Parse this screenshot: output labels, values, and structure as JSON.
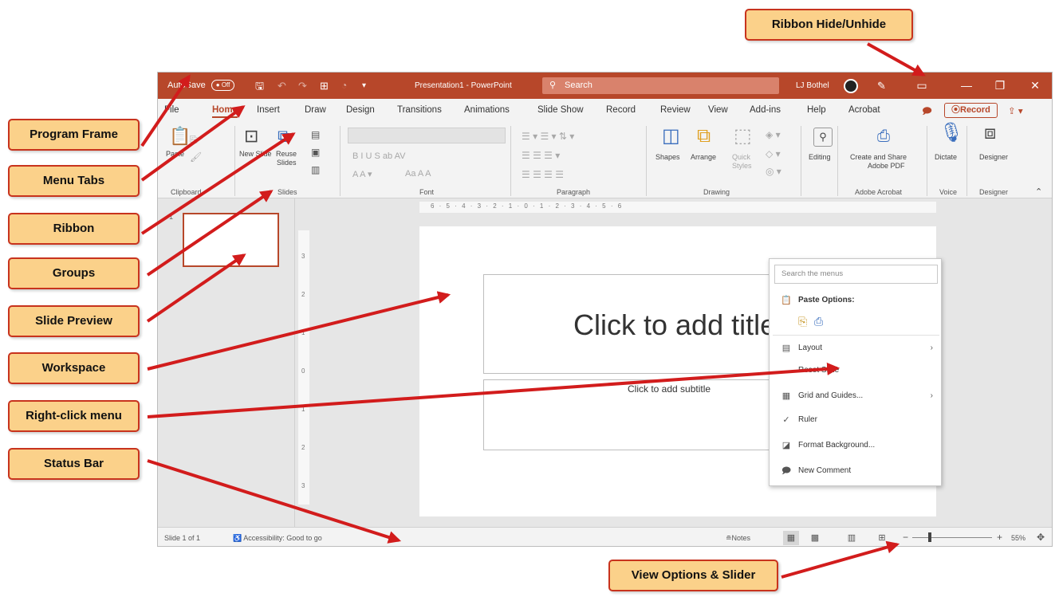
{
  "titlebar": {
    "autosave_label": "AutoSave",
    "autosave_state": "Off",
    "doc_title": "Presentation1 - PowerPoint",
    "search_placeholder": "Search",
    "user_name": "LJ Bothel"
  },
  "tabs": [
    "File",
    "Home",
    "Insert",
    "Draw",
    "Design",
    "Transitions",
    "Animations",
    "Slide Show",
    "Record",
    "Review",
    "View",
    "Add-ins",
    "Help",
    "Acrobat"
  ],
  "record_button": "Record",
  "ribbon": {
    "clipboard": {
      "label": "Clipboard",
      "paste": "Paste"
    },
    "slides": {
      "label": "Slides",
      "new_slide": "New Slide",
      "reuse_slides_1": "Reuse",
      "reuse_slides_2": "Slides"
    },
    "font": {
      "label": "Font",
      "buttons": "B  I  U  S  ab  AV",
      "size_buttons": "Aa  A  A"
    },
    "paragraph": {
      "label": "Paragraph"
    },
    "drawing": {
      "label": "Drawing",
      "shapes": "Shapes",
      "arrange": "Arrange",
      "quick_styles_1": "Quick",
      "quick_styles_2": "Styles"
    },
    "editing": {
      "label": "Editing"
    },
    "acrobat": {
      "label": "Adobe Acrobat",
      "create_share_1": "Create and Share",
      "create_share_2": "Adobe PDF"
    },
    "voice": {
      "label": "Voice",
      "dictate": "Dictate"
    },
    "designer": {
      "label": "Designer",
      "designer_btn": "Designer"
    }
  },
  "thumbnail": {
    "number": "1"
  },
  "ruler": {
    "horizontal": "6 · 5 · 4 · 3 · 2 · 1 · 0 · 1 · 2 · 3 · 4 · 5 · 6",
    "vertical": [
      "3",
      "2",
      "1",
      "0",
      "1",
      "2",
      "3"
    ]
  },
  "slide": {
    "title_placeholder": "Click to add title",
    "subtitle_placeholder": "Click to add subtitle"
  },
  "context_menu": {
    "search_placeholder": "Search the menus",
    "paste_options": "Paste Options:",
    "items": [
      "Layout",
      "Reset Slide",
      "Grid and Guides...",
      "Ruler",
      "Format Background...",
      "New Comment"
    ]
  },
  "statusbar": {
    "slide_count": "Slide 1 of 1",
    "accessibility": "Accessibility: Good to go",
    "notes": "Notes",
    "zoom": "55%"
  },
  "callouts": {
    "ribbon_hide": "Ribbon Hide/Unhide",
    "program_frame": "Program Frame",
    "menu_tabs": "Menu Tabs",
    "ribbon": "Ribbon",
    "groups": "Groups",
    "slide_preview": "Slide Preview",
    "workspace": "Workspace",
    "right_click_menu": "Right-click menu",
    "status_bar": "Status Bar",
    "view_options": "View Options & Slider"
  },
  "colors": {
    "brand": "#b7472a",
    "callout_fill": "#fbd18a",
    "callout_border": "#c8331d",
    "arrow": "#d21c1c"
  }
}
